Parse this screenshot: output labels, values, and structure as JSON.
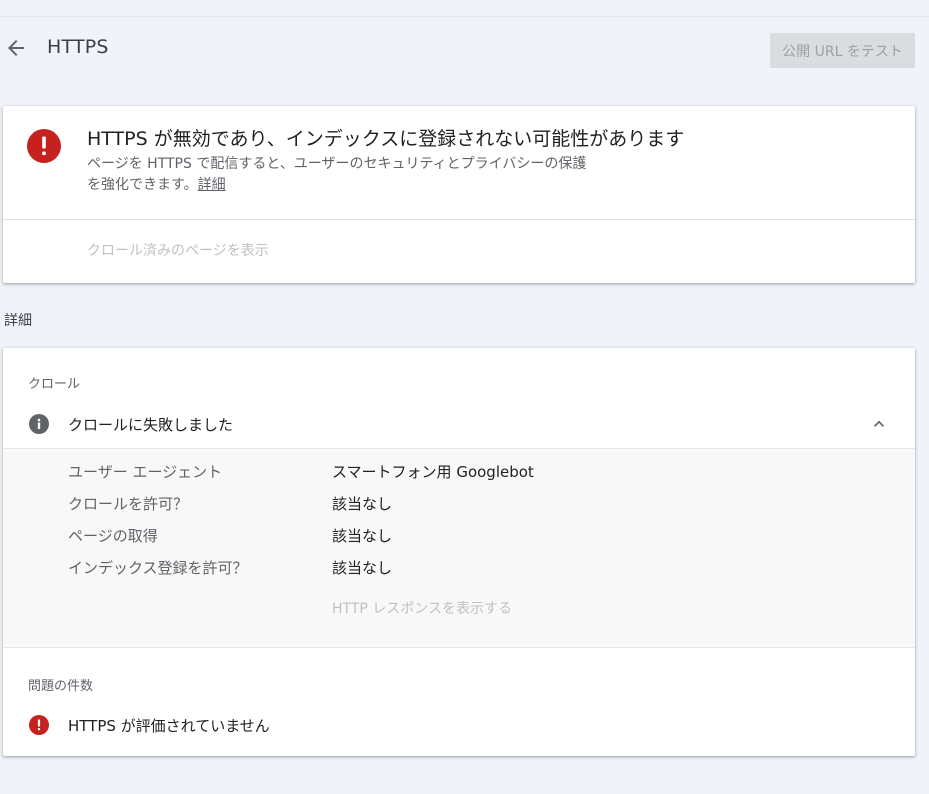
{
  "header": {
    "title": "HTTPS",
    "test_button": "公開 URL をテスト"
  },
  "status": {
    "title": "HTTPS が無効であり、インデックスに登録されない可能性があります",
    "desc_line1": "ページを HTTPS で配信すると、ユーザーのセキュリティとプライバシーの保護",
    "desc_line2": "を強化できます。",
    "desc_link": "詳細",
    "view_crawled": "クロール済みのページを表示"
  },
  "details_label": "詳細",
  "crawl": {
    "label": "クロール",
    "status": "クロールに失敗しました",
    "rows": [
      {
        "key": "ユーザー エージェント",
        "value": "スマートフォン用 Googlebot"
      },
      {
        "key": "クロールを許可？",
        "value": "該当なし"
      },
      {
        "key": "ページの取得",
        "value": "該当なし"
      },
      {
        "key": "インデックス登録を許可？",
        "value": "該当なし"
      }
    ],
    "http_response_link": "HTTP レスポンスを表示する"
  },
  "issues": {
    "label": "問題の件数",
    "items": [
      "HTTPS が評価されていません"
    ]
  },
  "colors": {
    "error": "#c5221f",
    "info": "#5f6368",
    "background": "#f0f4fa"
  },
  "icons": [
    "back-arrow-icon",
    "error-icon",
    "info-icon",
    "chevron-up-icon"
  ]
}
